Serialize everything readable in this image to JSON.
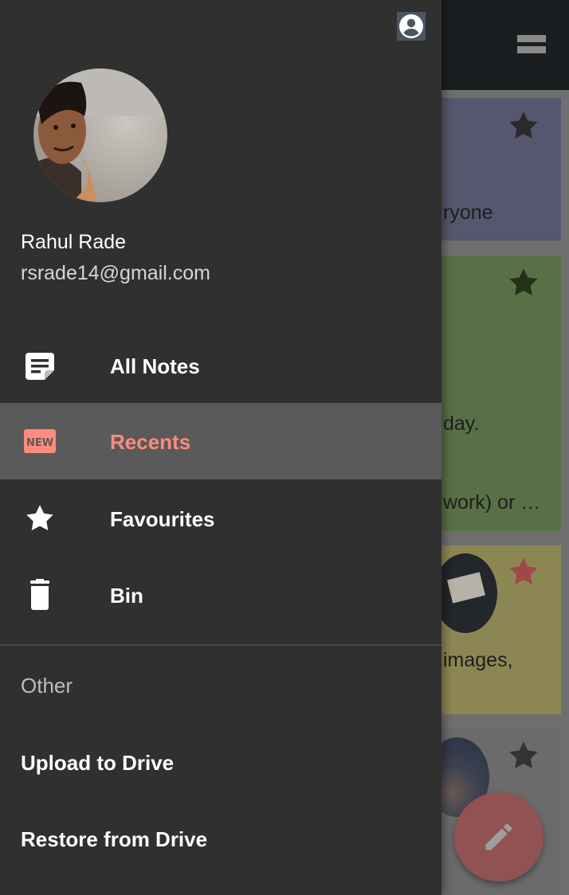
{
  "drawer": {
    "user": {
      "name": "Rahul Rade",
      "email": "rsrade14@gmail.com"
    },
    "nav_items": [
      {
        "label": "All Notes",
        "icon": "note-icon",
        "active": false
      },
      {
        "label": "Recents",
        "icon": "new-badge-icon",
        "active": true
      },
      {
        "label": "Favourites",
        "icon": "star-icon",
        "active": false
      },
      {
        "label": "Bin",
        "icon": "trash-icon",
        "active": false
      }
    ],
    "other": {
      "header": "Other",
      "items": [
        {
          "label": "Upload to Drive"
        },
        {
          "label": "Restore from Drive"
        }
      ]
    }
  },
  "background": {
    "notes": [
      {
        "fragment": "ryone",
        "starred": false
      },
      {
        "fragment_1": "day.",
        "fragment_2": "work) or …",
        "starred": false
      },
      {
        "fragment": "images,",
        "starred": true
      },
      {
        "fragment": "",
        "starred": false
      }
    ]
  },
  "colors": {
    "accent": "#ff8a80",
    "drawer_bg": "#303030",
    "active_row": "#5a5a5a",
    "fab": "#e57373"
  }
}
